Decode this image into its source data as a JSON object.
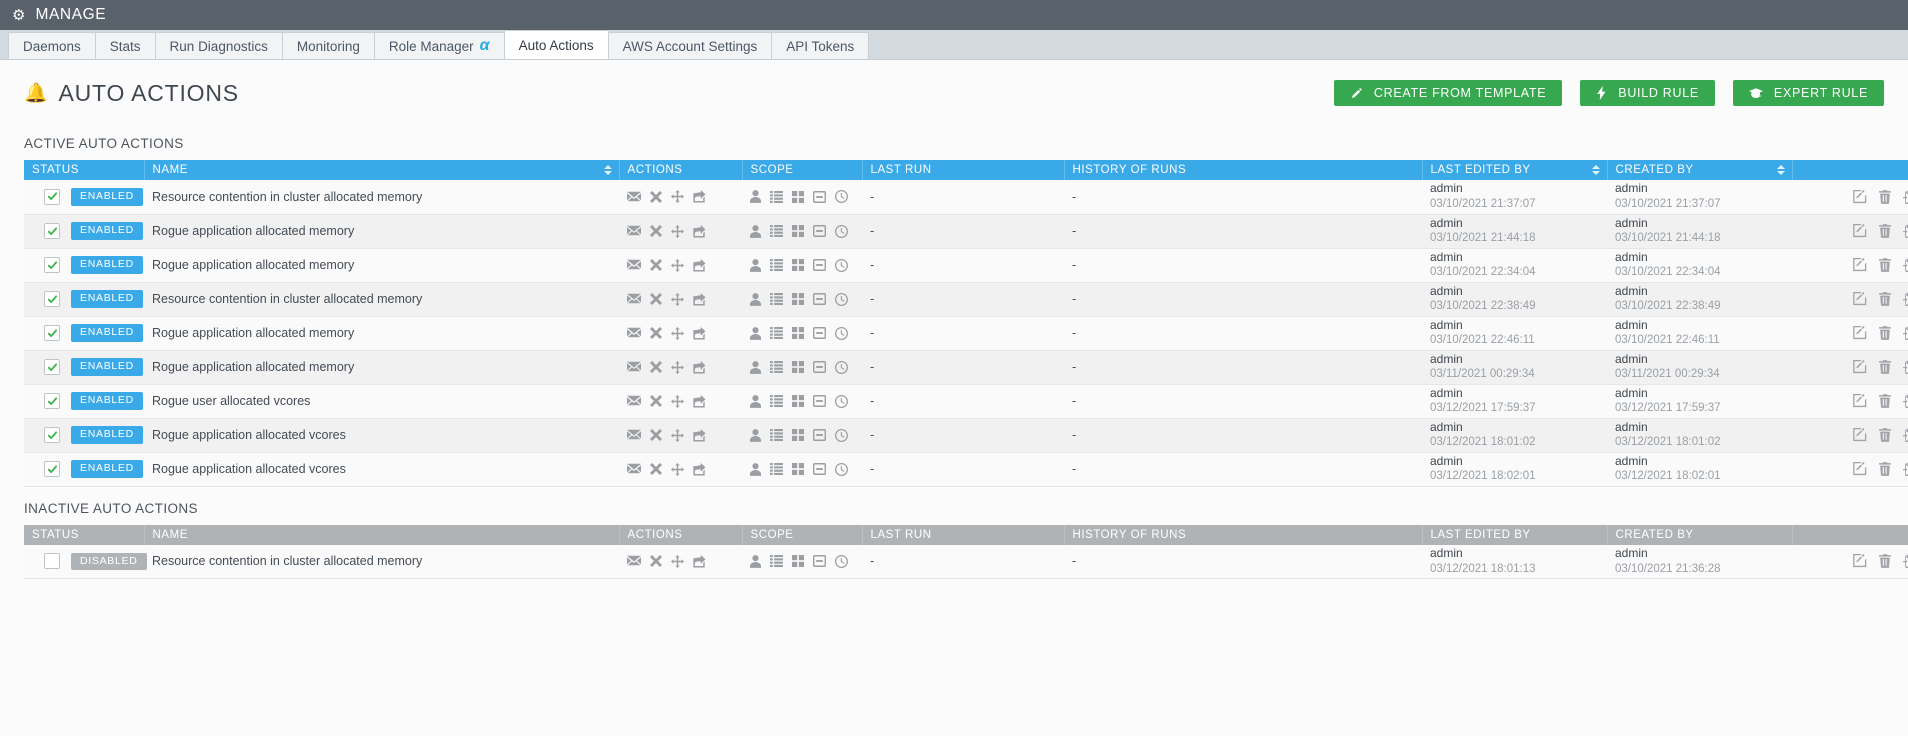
{
  "topbar": {
    "title": "MANAGE",
    "gear_icon": "gear-icon"
  },
  "tabs": [
    {
      "label": "Daemons",
      "active": false
    },
    {
      "label": "Stats",
      "active": false
    },
    {
      "label": "Run Diagnostics",
      "active": false
    },
    {
      "label": "Monitoring",
      "active": false
    },
    {
      "label": "Role Manager",
      "active": false,
      "suffix": "α"
    },
    {
      "label": "Auto Actions",
      "active": true
    },
    {
      "label": "AWS Account Settings",
      "active": false
    },
    {
      "label": "API Tokens",
      "active": false
    }
  ],
  "page": {
    "title": "AUTO ACTIONS",
    "title_icon": "bell-icon",
    "buttons": [
      {
        "label": "CREATE FROM TEMPLATE",
        "icon": "pencil-icon"
      },
      {
        "label": "BUILD RULE",
        "icon": "lightning-bolt-icon"
      },
      {
        "label": "EXPERT RULE",
        "icon": "graduation-cap-icon"
      }
    ],
    "accent_green": "#37a84f",
    "accent_blue": "#3aa9e8",
    "header_gray": "#b0b3b6"
  },
  "active_section": {
    "label": "ACTIVE AUTO ACTIONS",
    "columns": [
      {
        "key": "status",
        "label": "STATUS",
        "sortable": false
      },
      {
        "key": "name",
        "label": "NAME",
        "sortable": true
      },
      {
        "key": "actions",
        "label": "ACTIONS",
        "sortable": false
      },
      {
        "key": "scope",
        "label": "SCOPE",
        "sortable": false
      },
      {
        "key": "lastrun",
        "label": "LAST RUN",
        "sortable": false
      },
      {
        "key": "history",
        "label": "HISTORY OF RUNS",
        "sortable": false
      },
      {
        "key": "edited",
        "label": "LAST EDITED BY",
        "sortable": true
      },
      {
        "key": "created",
        "label": "CREATED BY",
        "sortable": true
      },
      {
        "key": "rowacts",
        "label": "",
        "sortable": false
      }
    ],
    "rows": [
      {
        "checked": true,
        "status": "ENABLED",
        "name": "Resource contention in cluster allocated memory",
        "last_run": "-",
        "history": "-",
        "edited_by": "admin",
        "edited_at": "03/10/2021 21:37:07",
        "created_by": "admin",
        "created_at": "03/10/2021 21:37:07"
      },
      {
        "checked": true,
        "status": "ENABLED",
        "name": "Rogue application allocated memory",
        "last_run": "-",
        "history": "-",
        "edited_by": "admin",
        "edited_at": "03/10/2021 21:44:18",
        "created_by": "admin",
        "created_at": "03/10/2021 21:44:18"
      },
      {
        "checked": true,
        "status": "ENABLED",
        "name": "Rogue application allocated memory",
        "last_run": "-",
        "history": "-",
        "edited_by": "admin",
        "edited_at": "03/10/2021 22:34:04",
        "created_by": "admin",
        "created_at": "03/10/2021 22:34:04"
      },
      {
        "checked": true,
        "status": "ENABLED",
        "name": "Resource contention in cluster allocated memory",
        "last_run": "-",
        "history": "-",
        "edited_by": "admin",
        "edited_at": "03/10/2021 22:38:49",
        "created_by": "admin",
        "created_at": "03/10/2021 22:38:49"
      },
      {
        "checked": true,
        "status": "ENABLED",
        "name": "Rogue application allocated memory",
        "last_run": "-",
        "history": "-",
        "edited_by": "admin",
        "edited_at": "03/10/2021 22:46:11",
        "created_by": "admin",
        "created_at": "03/10/2021 22:46:11"
      },
      {
        "checked": true,
        "status": "ENABLED",
        "name": "Rogue application allocated memory",
        "last_run": "-",
        "history": "-",
        "edited_by": "admin",
        "edited_at": "03/11/2021 00:29:34",
        "created_by": "admin",
        "created_at": "03/11/2021 00:29:34"
      },
      {
        "checked": true,
        "status": "ENABLED",
        "name": "Rogue user allocated vcores",
        "last_run": "-",
        "history": "-",
        "edited_by": "admin",
        "edited_at": "03/12/2021 17:59:37",
        "created_by": "admin",
        "created_at": "03/12/2021 17:59:37"
      },
      {
        "checked": true,
        "status": "ENABLED",
        "name": "Rogue application allocated vcores",
        "last_run": "-",
        "history": "-",
        "edited_by": "admin",
        "edited_at": "03/12/2021 18:01:02",
        "created_by": "admin",
        "created_at": "03/12/2021 18:01:02"
      },
      {
        "checked": true,
        "status": "ENABLED",
        "name": "Rogue application allocated vcores",
        "last_run": "-",
        "history": "-",
        "edited_by": "admin",
        "edited_at": "03/12/2021 18:02:01",
        "created_by": "admin",
        "created_at": "03/12/2021 18:02:01"
      }
    ]
  },
  "inactive_section": {
    "label": "INACTIVE AUTO ACTIONS",
    "columns": [
      {
        "key": "status",
        "label": "STATUS"
      },
      {
        "key": "name",
        "label": "NAME"
      },
      {
        "key": "actions",
        "label": "ACTIONS"
      },
      {
        "key": "scope",
        "label": "SCOPE"
      },
      {
        "key": "lastrun",
        "label": "LAST RUN"
      },
      {
        "key": "history",
        "label": "HISTORY OF RUNS"
      },
      {
        "key": "edited",
        "label": "LAST EDITED BY"
      },
      {
        "key": "created",
        "label": "CREATED BY"
      },
      {
        "key": "rowacts",
        "label": ""
      }
    ],
    "rows": [
      {
        "checked": false,
        "status": "DISABLED",
        "name": "Resource contention in cluster allocated memory",
        "last_run": "-",
        "history": "-",
        "edited_by": "admin",
        "edited_at": "03/12/2021 18:01:13",
        "created_by": "admin",
        "created_at": "03/10/2021 21:36:28"
      }
    ]
  },
  "icons": {
    "action_icons": [
      "envelope-icon",
      "kill-x-icon",
      "move-icon",
      "share-icon"
    ],
    "scope_icons": [
      "user-icon",
      "list-icon",
      "grid-icon",
      "window-icon",
      "clock-icon"
    ],
    "row_action_icons": [
      "edit-icon",
      "trash-icon",
      "clone-icon"
    ]
  }
}
